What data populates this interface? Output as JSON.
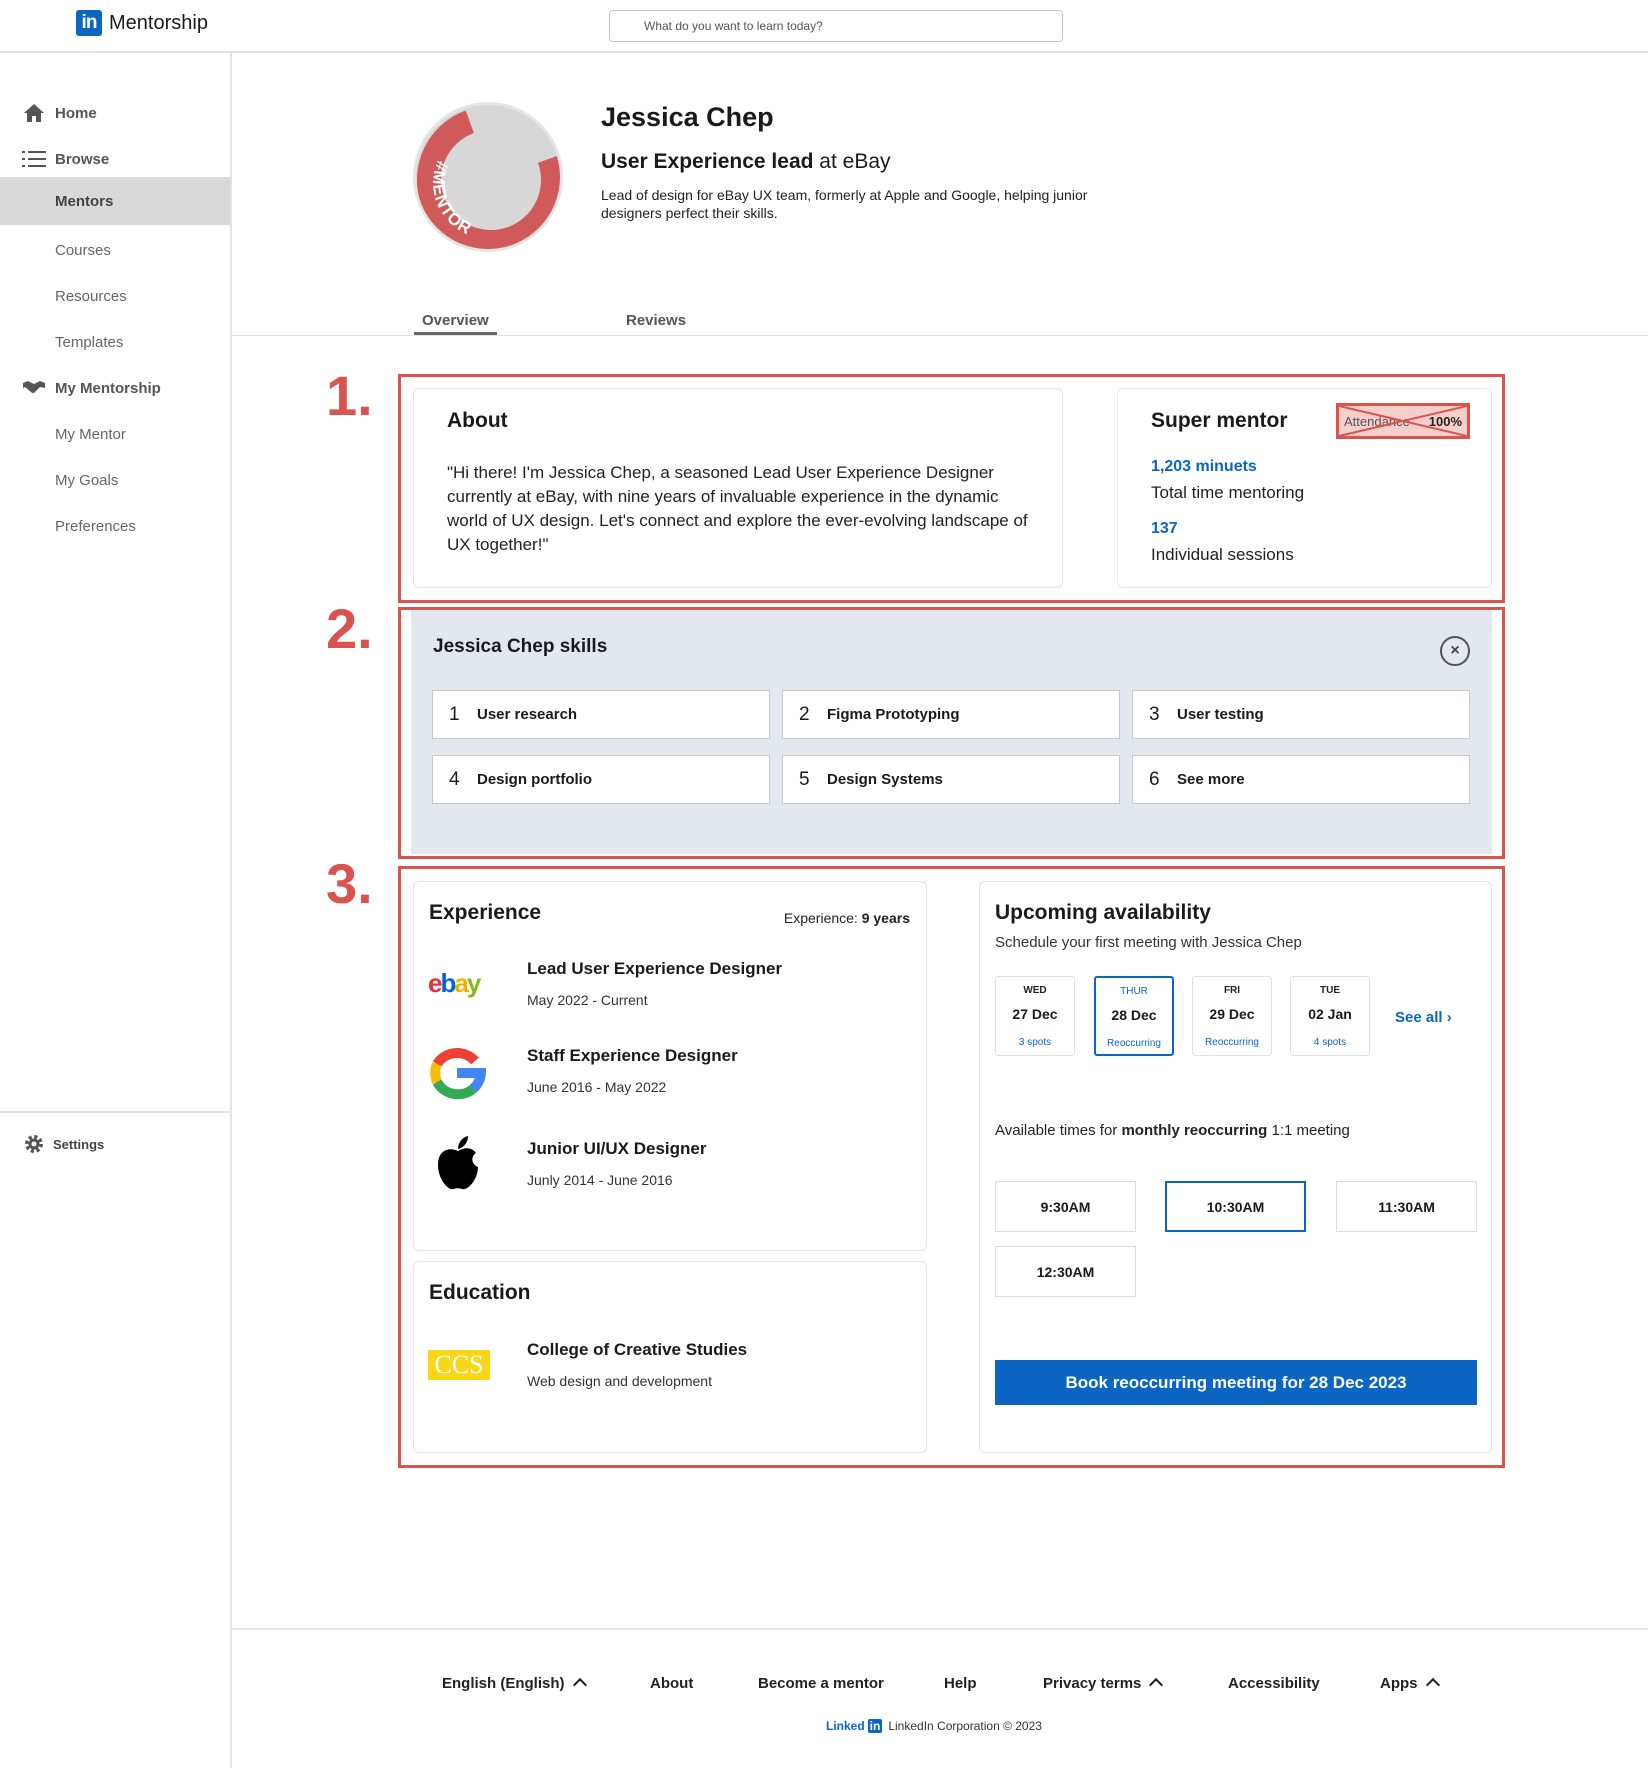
{
  "header": {
    "brand_logo": "in",
    "brand_name": "Mentorship",
    "search_placeholder": "What do you want to learn today?"
  },
  "sidebar": {
    "items": [
      {
        "label": "Home",
        "icon": "home-icon"
      },
      {
        "label": "Browse",
        "icon": "list-icon"
      },
      {
        "label": "Mentors"
      },
      {
        "label": "Courses"
      },
      {
        "label": "Resources"
      },
      {
        "label": "Templates"
      },
      {
        "label": "My Mentorship",
        "icon": "handshake-icon"
      },
      {
        "label": "My Mentor"
      },
      {
        "label": "My Goals"
      },
      {
        "label": "Preferences"
      }
    ],
    "settings_label": "Settings"
  },
  "profile": {
    "avatar_badge": "#MENTOR",
    "name": "Jessica Chep",
    "role_title": "User Experience lead",
    "role_company": " at eBay",
    "bio": "Lead of design for eBay UX team, formerly  at Apple and Google, helping junior designers perfect their skills."
  },
  "tabs": [
    "Overview",
    "Reviews"
  ],
  "annotations": [
    "1.",
    "2.",
    "3."
  ],
  "about": {
    "title": "About",
    "text": "\"Hi there! I'm Jessica Chep, a seasoned Lead User Experience Designer currently at eBay, with nine years of invaluable experience in the dynamic world of UX design. Let's connect and explore the ever-evolving landscape of UX together!\""
  },
  "super_mentor": {
    "title": "Super mentor",
    "badge_label": "Attendance",
    "badge_value": "100%",
    "minutes_value": "1,203 minuets",
    "minutes_label": "Total time mentoring",
    "sessions_value": "137",
    "sessions_label": "Individual sessions"
  },
  "skills": {
    "title": "Jessica Chep skills",
    "close_symbol": "×",
    "items": [
      {
        "num": "1",
        "name": "User research"
      },
      {
        "num": "2",
        "name": "Figma Prototyping"
      },
      {
        "num": "3",
        "name": "User testing"
      },
      {
        "num": "4",
        "name": "Design portfolio"
      },
      {
        "num": "5",
        "name": "Design Systems"
      },
      {
        "num": "6",
        "name": "See more"
      }
    ]
  },
  "experience": {
    "title": "Experience",
    "meta_label": "Experience: ",
    "meta_value": "9 years",
    "jobs": [
      {
        "title": "Lead User Experience Designer",
        "dates": "May 2022 - Current",
        "logo": "ebay-logo"
      },
      {
        "title": "Staff Experience Designer",
        "dates": "June 2016 - May 2022",
        "logo": "google-logo"
      },
      {
        "title": "Junior UI/UX Designer",
        "dates": "Junly 2014 - June 2016",
        "logo": "apple-logo"
      }
    ]
  },
  "education": {
    "title": "Education",
    "school": "College of Creative Studies",
    "program": "Web design and development",
    "logo_text": "CCS"
  },
  "availability": {
    "title": "Upcoming availability",
    "subtitle": "Schedule your first meeting with Jessica Chep",
    "days": [
      {
        "dow": "WED",
        "date": "27 Dec",
        "note": "3 spots",
        "selected": false
      },
      {
        "dow": "THUR",
        "date": "28 Dec",
        "note": "Reoccurring",
        "selected": true
      },
      {
        "dow": "FRI",
        "date": "29 Dec",
        "note": "Reoccurring",
        "selected": false
      },
      {
        "dow": "TUE",
        "date": "02 Jan",
        "note": "4 spots",
        "selected": false
      }
    ],
    "see_all": "See all",
    "note_prefix": "Available times for ",
    "note_bold": "monthly reoccurring",
    "note_suffix": " 1:1 meeting",
    "slots": [
      "9:30AM",
      "10:30AM",
      "11:30AM",
      "12:30AM"
    ],
    "selected_slot": "10:30AM",
    "book_button": "Book reoccurring meeting for 28 Dec 2023"
  },
  "footer": {
    "links": [
      "English (English)",
      "About",
      "Become a mentor",
      "Help",
      "Privacy terms",
      "Accessibility",
      "Apps"
    ],
    "copyright_brand": "Linked",
    "copyright_box": "in",
    "copyright_text": "LinkedIn Corporation © 2023"
  },
  "colors": {
    "accent": "#0a66c2",
    "annotation": "#d9534f",
    "skills_bg": "#e2e8ee"
  }
}
